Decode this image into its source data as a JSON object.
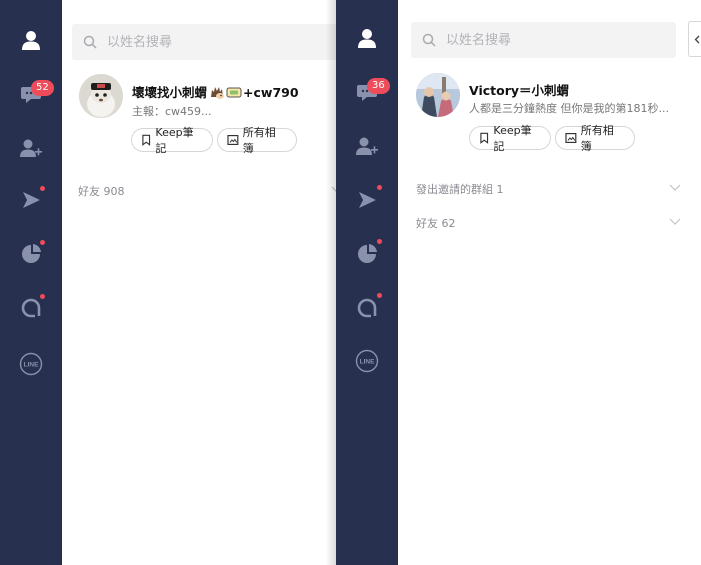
{
  "left_panel": {
    "nav": {
      "chats_badge": "52"
    },
    "search": {
      "placeholder": "以姓名搜尋"
    },
    "profile": {
      "name": "壞壞找小刺蝟",
      "name_suffix": "+cw790",
      "status": "主報：cw459..."
    },
    "keep_label": "Keep筆記",
    "albums_label": "所有相簿",
    "sections": [
      {
        "label": "好友 908"
      }
    ]
  },
  "right_panel": {
    "nav": {
      "chats_badge": "36"
    },
    "search": {
      "placeholder": "以姓名搜尋"
    },
    "profile": {
      "name": "Victory＝小刺蝟",
      "status": "人都是三分鐘熱度 但你是我的第181秒..."
    },
    "keep_label": "Keep筆記",
    "albums_label": "所有相簿",
    "sections": [
      {
        "label": "發出邀請的群組 1"
      },
      {
        "label": "好友 62"
      }
    ]
  },
  "colors": {
    "sidebar": "#283050",
    "badge": "#ef4c5b",
    "active_icon": "#ffffff",
    "inactive_icon": "#8a91ad"
  },
  "icons": [
    "person-icon",
    "chat-icon",
    "add-friend-icon",
    "play-icon",
    "pie-icon",
    "a-icon",
    "line-icon",
    "search-icon",
    "bookmark-icon",
    "album-icon",
    "chevron-down-icon",
    "chevron-left-icon"
  ]
}
